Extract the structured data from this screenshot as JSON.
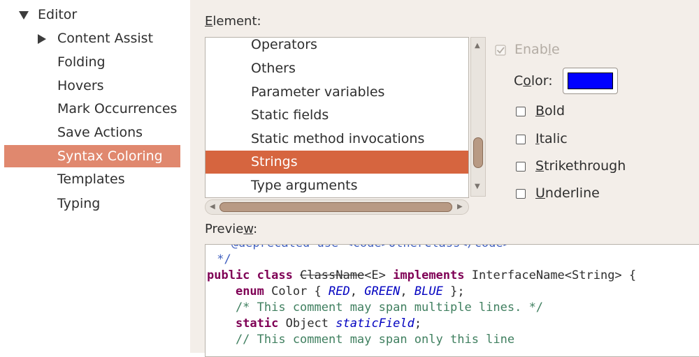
{
  "tree": {
    "items": [
      {
        "label": "Editor",
        "expander": "expanded"
      },
      {
        "label": "Content Assist",
        "expander": "collapsed"
      },
      {
        "label": "Folding"
      },
      {
        "label": "Hovers"
      },
      {
        "label": "Mark Occurrences"
      },
      {
        "label": "Save Actions"
      },
      {
        "label": "Syntax Coloring",
        "selected": true
      },
      {
        "label": "Templates"
      },
      {
        "label": "Typing"
      }
    ]
  },
  "element": {
    "label_pre": "",
    "label_mnemonic": "E",
    "label_post": "lement:",
    "items": [
      {
        "label": "Operators"
      },
      {
        "label": "Others"
      },
      {
        "label": "Parameter variables"
      },
      {
        "label": "Static fields"
      },
      {
        "label": "Static method invocations"
      },
      {
        "label": "Strings",
        "selected": true
      },
      {
        "label": "Type arguments"
      }
    ]
  },
  "options": {
    "enable": {
      "pre": "Enab",
      "mnemonic": "l",
      "post": "e",
      "checked": true,
      "disabled": true
    },
    "color": {
      "pre": "C",
      "mnemonic": "o",
      "post": "lor:",
      "value": "#0000ff"
    },
    "bold": {
      "pre": "",
      "mnemonic": "B",
      "post": "old",
      "checked": false
    },
    "italic": {
      "pre": "",
      "mnemonic": "I",
      "post": "talic",
      "checked": false
    },
    "strikethrough": {
      "pre": "",
      "mnemonic": "S",
      "post": "trikethrough",
      "checked": false
    },
    "underline": {
      "pre": "",
      "mnemonic": "U",
      "post": "nderline",
      "checked": false
    }
  },
  "preview": {
    "label_pre": "Previe",
    "label_mnemonic": "w",
    "label_post": ":",
    "line0": " * @deprecated use <code>OtherClass</code>",
    "line1": " */",
    "line2": {
      "kw1": "public class ",
      "strike": "ClassName",
      "mid": "<E> ",
      "kw2": "implements",
      "rest": " InterfaceName<String> {"
    },
    "line3": {
      "indent": "    ",
      "kw": "enum",
      "a": " Color { ",
      "e1": "RED",
      "c1": ", ",
      "e2": "GREEN",
      "c2": ", ",
      "e3": "BLUE",
      "end": " };"
    },
    "line4": "    /* This comment may span multiple lines. */",
    "line5": {
      "indent": "    ",
      "kw": "static",
      "a": " Object ",
      "field": "staticField",
      "end": ";"
    },
    "line6": "    // This comment may span only this line"
  },
  "colors": {
    "selection_tree": "#e0886e",
    "selection_list": "#d6653f",
    "panel_bg": "#f3eee9",
    "keyword": "#7f0055",
    "comment": "#3f7f5f",
    "javadoc": "#3f5fbf",
    "enum_field": "#0000c0"
  }
}
